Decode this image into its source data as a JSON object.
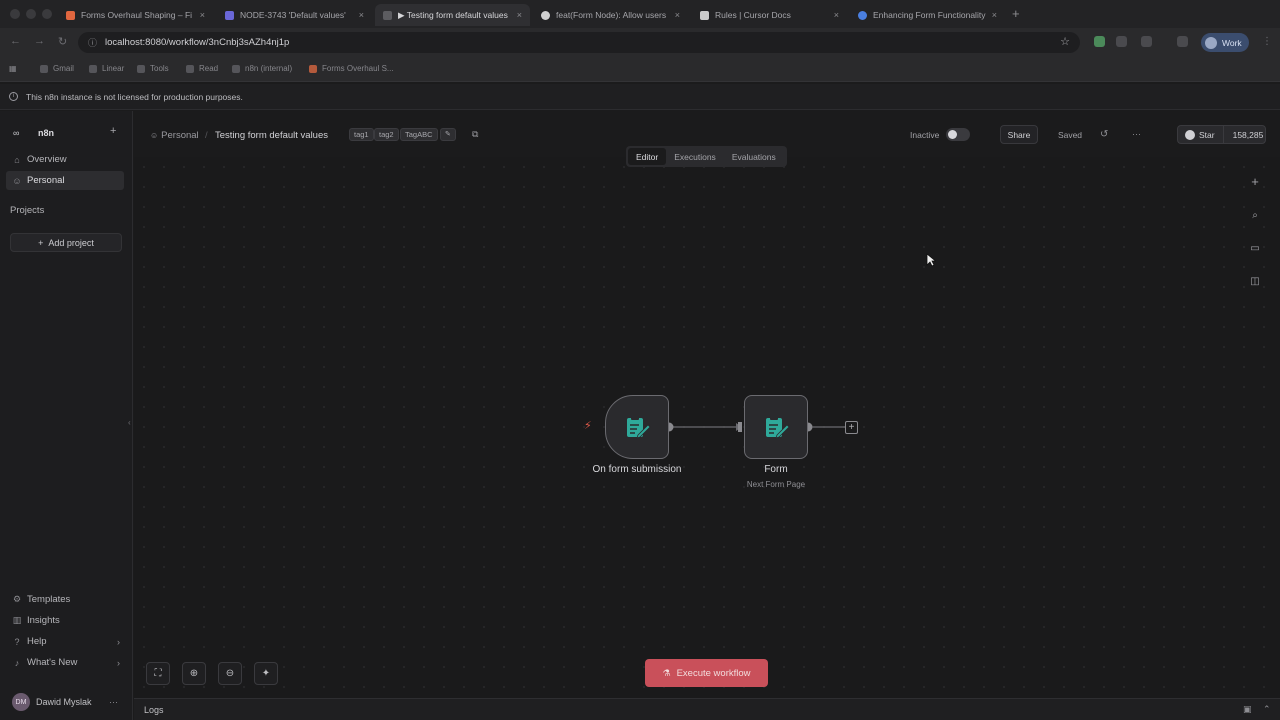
{
  "browser": {
    "tabs": [
      {
        "title": "Forms Overhaul Shaping – Fi",
        "favicon_color": "#e0663f",
        "active": false
      },
      {
        "title": "NODE-3743 'Default values'",
        "favicon_color": "#6a67d8",
        "active": false
      },
      {
        "title": "▶ Testing form default values",
        "favicon_color": "#888888",
        "active": true
      },
      {
        "title": "feat(Form Node): Allow users",
        "favicon_color": "#d0d0d0",
        "active": false
      },
      {
        "title": "Rules | Cursor Docs",
        "favicon_color": "#cccccc",
        "active": false
      },
      {
        "title": "Enhancing Form Functionality",
        "favicon_color": "#4a7fe0",
        "active": false
      }
    ],
    "tab_close": "×",
    "new_tab": "+",
    "url": "localhost:8080/workflow/3nCnbj3sAZh4nj1p",
    "profile_label": "Work",
    "bookmarks": [
      "Gmail",
      "Linear",
      "Tools",
      "Read",
      "n8n (internal)",
      "Forms Overhaul S..."
    ]
  },
  "license_banner": "This n8n instance is not licensed for production purposes.",
  "sidebar": {
    "logo_text": "n8n",
    "items": [
      {
        "label": "Overview",
        "icon": "home-icon"
      },
      {
        "label": "Personal",
        "icon": "user-icon"
      }
    ],
    "projects_heading": "Projects",
    "add_project": "Add project",
    "bottom_items": [
      {
        "label": "Templates",
        "icon": "templates-icon"
      },
      {
        "label": "Insights",
        "icon": "insights-icon"
      },
      {
        "label": "Help",
        "icon": "help-icon"
      },
      {
        "label": "What's New",
        "icon": "bell-icon"
      }
    ],
    "user_initials": "DM",
    "user_name": "Dawid Myslak"
  },
  "header": {
    "breadcrumb_project": "Personal",
    "workflow_name": "Testing form default values",
    "tags": [
      "tag1",
      "tag2",
      "TagABC"
    ],
    "active_state": "Inactive",
    "share": "Share",
    "saved": "Saved",
    "more": "···",
    "github_star": "Star",
    "github_count": "158,285"
  },
  "view_tabs": [
    "Editor",
    "Executions",
    "Evaluations"
  ],
  "nodes": [
    {
      "label": "On form submission",
      "sub": ""
    },
    {
      "label": "Form",
      "sub": "Next Form Page"
    }
  ],
  "execute_button": "Execute workflow",
  "logs_label": "Logs",
  "colors": {
    "accent": "#c9505a",
    "node_icon": "#2fa99a"
  }
}
